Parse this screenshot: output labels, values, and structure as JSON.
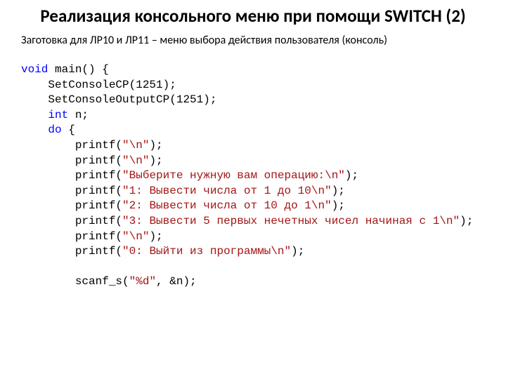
{
  "title": "Реализация консольного меню при помощи SWITCH (2)",
  "subtitle": "Заготовка для ЛР10 и ЛР11 – меню выбора действия пользователя (консоль)",
  "code": {
    "kw_void": "void",
    "main_sig": " main() {",
    "l_setcp": "    SetConsoleCP(1251);",
    "l_setoutcp": "    SetConsoleOutputCP(1251);",
    "indent4": "    ",
    "kw_int": "int",
    "decl_n": " n;",
    "kw_do": "do",
    "brace_open": " {",
    "indent8": "        ",
    "printf_open": "printf(",
    "close_stmt": ");",
    "q": "\"",
    "nl": "\\n",
    "s_prompt": "Выберите нужную вам операцию:",
    "s_opt1": "1: Вывести числа от 1 до 10",
    "s_opt2": "2: Вывести числа от 10 до 1",
    "s_opt3": "3: Вывести 5 первых нечетных чисел начиная с 1",
    "s_opt0": "0: Выйти из программы",
    "blank": "",
    "scanf_open": "scanf_s(",
    "fmt_d": "%d",
    "scanf_tail": ", &n);"
  }
}
